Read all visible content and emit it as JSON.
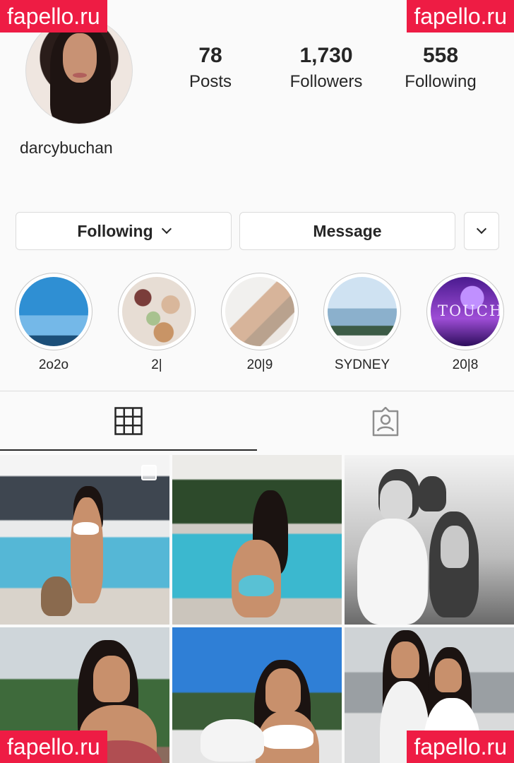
{
  "profile": {
    "username": "darcybuchan",
    "stats": {
      "posts_count": "78",
      "posts_label": "Posts",
      "followers_count": "1,730",
      "followers_label": "Followers",
      "following_count": "558",
      "following_label": "Following"
    }
  },
  "actions": {
    "following_label": "Following",
    "message_label": "Message"
  },
  "highlights": [
    {
      "label": "2o2o"
    },
    {
      "label": "2|"
    },
    {
      "label": "20|9"
    },
    {
      "label": "SYDNEY"
    },
    {
      "label": "20|8"
    }
  ],
  "highlight_thumb_text": "TOUCH",
  "tabs": {
    "grid_icon": "grid-icon",
    "tagged_icon": "tagged-icon"
  },
  "watermark": "fapello.ru",
  "colors": {
    "watermark_bg": "#ee1c44",
    "text": "#262626",
    "border": "#dbdbdb"
  }
}
